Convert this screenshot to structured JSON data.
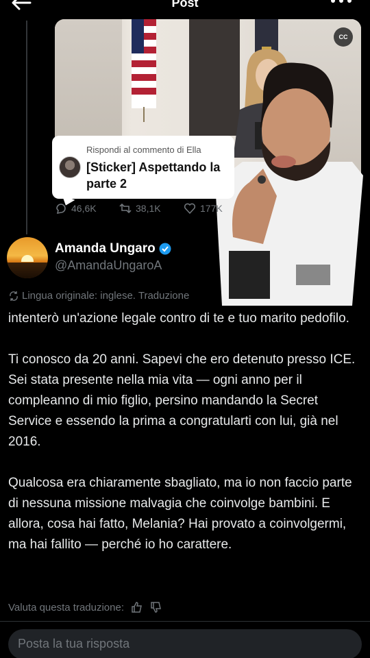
{
  "header": {
    "title": "Post",
    "back_icon": "arrow-left-icon",
    "more_icon": "more-icon"
  },
  "media": {
    "cc_label": "CC",
    "reply_card": {
      "heading": "Rispondi al commento di Ella",
      "text": "[Sticker] Aspettando la parte 2"
    }
  },
  "stats": {
    "replies": "46,6K",
    "reposts": "38,1K",
    "likes": "177K"
  },
  "author": {
    "name": "Amanda Ungaro",
    "handle": "@AmandaUngaroA",
    "verified_color": "#1d9bf0"
  },
  "translation": {
    "note": "Lingua originale: inglese. Traduzione",
    "paragraphs": [
      "intenterò un'azione legale contro di te e tuo marito pedofilo.",
      "Ti conosco da 20 anni. Sapevi che ero detenuto presso ICE. Sei stata presente nella mia vita — ogni anno per il compleanno di mio figlio, persino mandando la Secret Service e essendo la prima a congratularti con lui, già nel 2016.",
      "Qualcosa era chiaramente sbagliato, ma io non faccio parte di nessuna missione malvagia che coinvolge bambini. E allora, cosa hai fatto, Melania? Hai provato a coinvolgermi, ma hai fallito — perché io ho carattere."
    ],
    "rate_label": "Valuta questa traduzione:"
  },
  "reply_box": {
    "placeholder": "Posta la tua risposta"
  }
}
